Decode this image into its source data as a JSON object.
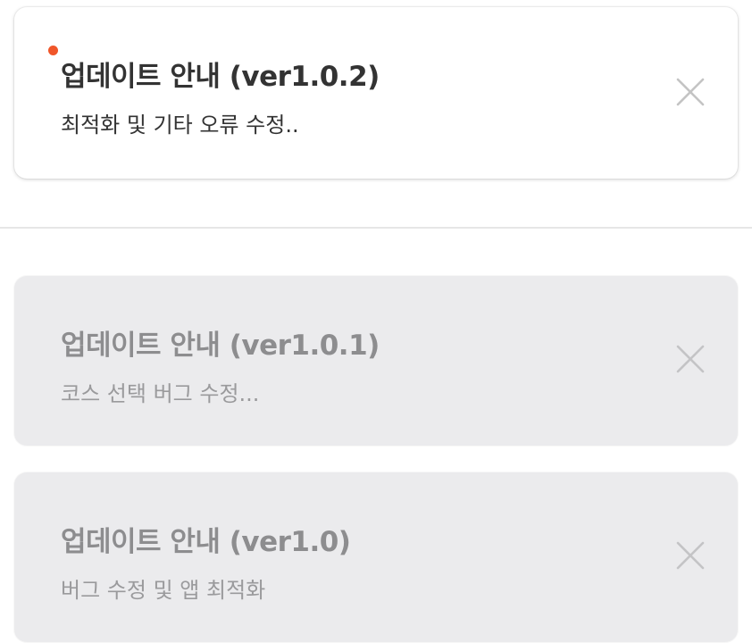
{
  "notices": [
    {
      "title": "업데이트 안내 (ver1.0.2)",
      "description": "최적화 및 기타 오류 수정..",
      "unread": true
    },
    {
      "title": "업데이트 안내 (ver1.0.1)",
      "description": "코스 선택 버그 수정...",
      "unread": false
    },
    {
      "title": "업데이트 안내 (ver1.0)",
      "description": "버그 수정 및 앱 최적화",
      "unread": false
    }
  ],
  "icons": {
    "unread": "unread-dot-icon",
    "close": "close-icon"
  },
  "colors": {
    "unread_dot": "#f0562a",
    "read_card_bg": "#ebebed",
    "unread_card_bg": "#ffffff"
  }
}
